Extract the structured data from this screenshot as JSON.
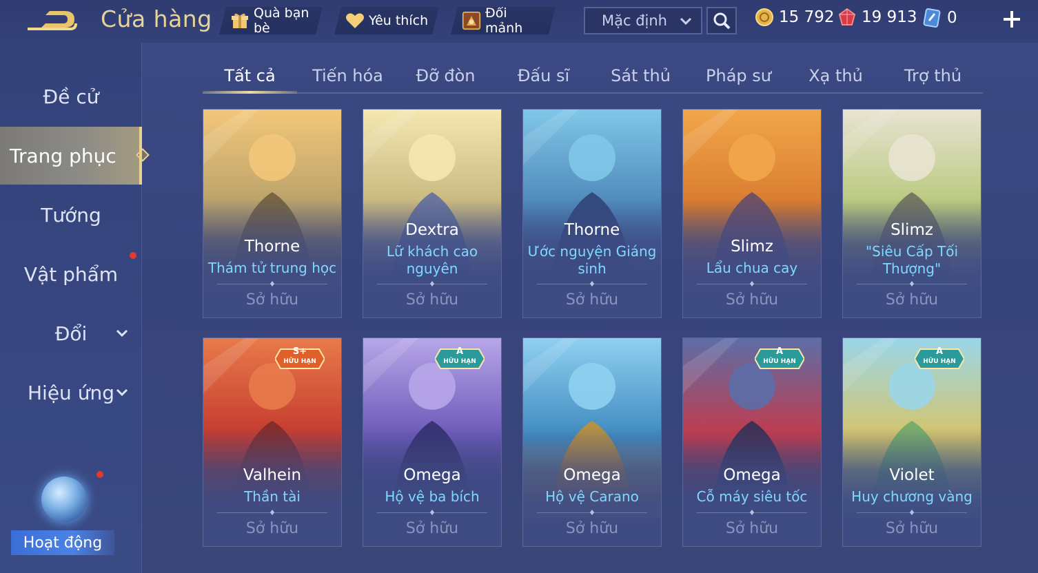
{
  "header": {
    "title": "Cửa hàng",
    "friend_gift_label": "Quà bạn bè",
    "favorites_label": "Yêu thích",
    "exchange_label": "Đổi mảnh",
    "sort_value": "Mặc định",
    "currencies": {
      "gold": "15 792",
      "ruby": "19 913",
      "voucher": "0"
    }
  },
  "sidebar": {
    "items": [
      {
        "label": "Đề cử"
      },
      {
        "label": "Trang phục"
      },
      {
        "label": "Tướng"
      },
      {
        "label": "Vật phẩm"
      },
      {
        "label": "Đổi"
      },
      {
        "label": "Hiệu ứng"
      }
    ],
    "event_label": "Hoạt động"
  },
  "tabs": [
    "Tất cả",
    "Tiến hóa",
    "Đỡ đòn",
    "Đấu sĩ",
    "Sát thủ",
    "Pháp sư",
    "Xạ thủ",
    "Trợ thủ"
  ],
  "cards": [
    {
      "hero": "Thorne",
      "skin": "Thám tử trung học",
      "status": "Sở hữu",
      "badge_grade": "",
      "badge_label": "",
      "colors": [
        "#f3c77a",
        "#b7a06a",
        "#6b5a3c"
      ]
    },
    {
      "hero": "Dextra",
      "skin": "Lữ khách cao nguyên",
      "status": "Sở hữu",
      "badge_grade": "",
      "badge_label": "",
      "colors": [
        "#f4e7b0",
        "#c6b67e",
        "#5b6aa0"
      ]
    },
    {
      "hero": "Thorne",
      "skin": "Ước nguyện Giáng sinh",
      "status": "Sở hữu",
      "badge_grade": "",
      "badge_label": "",
      "colors": [
        "#7fc7e8",
        "#4d86b8",
        "#2d3f73"
      ]
    },
    {
      "hero": "Slimz",
      "skin": "Lẩu chua cay",
      "status": "Sở hữu",
      "badge_grade": "",
      "badge_label": "",
      "colors": [
        "#f2a64a",
        "#d77a2e",
        "#5d4a6e"
      ]
    },
    {
      "hero": "Slimz",
      "skin": "\"Siêu Cấp Tối Thượng\"",
      "status": "Sở hữu",
      "badge_grade": "",
      "badge_label": "",
      "colors": [
        "#e8e3d2",
        "#b7c87a",
        "#6a6a5a"
      ]
    },
    {
      "hero": "Valhein",
      "skin": "Thần tài",
      "status": "Sở hữu",
      "badge_grade": "S+",
      "badge_label": "HỮU HẠN",
      "colors": [
        "#e87a4a",
        "#c43a2e",
        "#7a2a2a"
      ]
    },
    {
      "hero": "Omega",
      "skin": "Hộ vệ ba bích",
      "status": "Sở hữu",
      "badge_grade": "A",
      "badge_label": "HỮU HẠN",
      "colors": [
        "#b7a6e8",
        "#6a58b8",
        "#2f2c66"
      ]
    },
    {
      "hero": "Omega",
      "skin": "Hộ vệ Carano",
      "status": "Sở hữu",
      "badge_grade": "",
      "badge_label": "",
      "colors": [
        "#8fd0f0",
        "#3f8ac0",
        "#c9902e"
      ]
    },
    {
      "hero": "Omega",
      "skin": "Cỗ máy siêu tốc",
      "status": "Sở hữu",
      "badge_grade": "A",
      "badge_label": "HỮU HẠN",
      "colors": [
        "#5c6ea8",
        "#c43a4a",
        "#2a2e55"
      ]
    },
    {
      "hero": "Violet",
      "skin": "Huy chương vàng",
      "status": "Sở hữu",
      "badge_grade": "A",
      "badge_label": "HỮU HẠN",
      "colors": [
        "#9ad6e8",
        "#d6c46a",
        "#6aa86a"
      ]
    }
  ]
}
